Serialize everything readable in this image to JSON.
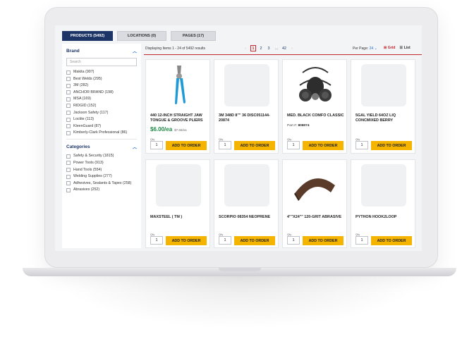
{
  "tabs": [
    {
      "label": "PRODUCTS (5492)"
    },
    {
      "label": "LOCATIONS (0)"
    },
    {
      "label": "PAGES (17)"
    }
  ],
  "sidebar": {
    "brand_title": "Brand",
    "search_placeholder": "Search",
    "brands": [
      "Makita (907)",
      "Best Welds (295)",
      "3M (282)",
      "ANCHOR BRAND (198)",
      "MSA (169)",
      "RIDGID (152)",
      "Jackson Safety (117)",
      "Loctite (113)",
      "KleenGuard (87)",
      "Kimberly-Clark Professional (86)"
    ],
    "categories_title": "Categories",
    "categories": [
      "Safety & Security (1815)",
      "Power Tools (913)",
      "Hand Tools (554)",
      "Welding Supplies (277)",
      "Adhesives, Sealants & Tapes (258)",
      "Abrasives (252)"
    ]
  },
  "toolbar": {
    "displaying": "Displaying Items 1 - 24 of 5492 results",
    "pages": [
      "‹",
      "1",
      "2",
      "3",
      "...",
      "42",
      "›"
    ],
    "per_page_label": "Per Page:",
    "per_page_value": "24 ⌄",
    "grid_label": "Grid",
    "list_label": "List",
    "grid_icon": "grid-icon",
    "list_icon": "list-icon"
  },
  "products": [
    {
      "title": "440 12-INCH STRAIGHT JAW TONGUE & GROOVE PLIERS",
      "price": "$6.00/ea",
      "was": "$7.66/ea",
      "qty_label": "Qty",
      "qty": "1",
      "button": "ADD TO ORDER",
      "image": "pliers"
    },
    {
      "title": "3M 348D 8\"\" 36 DISC051144-20874",
      "qty_label": "Qty",
      "qty": "1",
      "button": "ADD TO ORDER",
      "image": "placeholder"
    },
    {
      "title": "MED. BLACK COMFO CLASSIC",
      "part_label": "Part #:",
      "part_no": "808074",
      "qty_label": "Qty",
      "qty": "1",
      "button": "ADD TO ORDER",
      "image": "respirator"
    },
    {
      "title": "5GAL YIELD 64OZ LIQ CONCMIXED BERRY",
      "qty_label": "Qty",
      "qty": "1",
      "button": "ADD TO ORDER",
      "image": "placeholder"
    },
    {
      "title": "MAXSTEEL ( TM )",
      "qty_label": "Qty",
      "qty": "1",
      "button": "ADD TO ORDER",
      "image": "placeholder"
    },
    {
      "title": "SCORPIO 08354 NEOPRENE",
      "qty_label": "Qty",
      "qty": "1",
      "button": "ADD TO ORDER",
      "image": "placeholder"
    },
    {
      "title": "4\"\"X24\"\" 120-GRIT ABRASIVE",
      "qty_label": "Qty",
      "qty": "1",
      "button": "ADD TO ORDER",
      "image": "abrasive-belt"
    },
    {
      "title": "PYTHON HOOK2LOOP",
      "qty_label": "Qty",
      "qty": "1",
      "button": "ADD TO ORDER",
      "image": "placeholder"
    }
  ],
  "colors": {
    "navy": "#1c3566",
    "accent_red": "#c2262e",
    "button_yellow": "#f5b400",
    "price_green": "#1d8a46"
  }
}
